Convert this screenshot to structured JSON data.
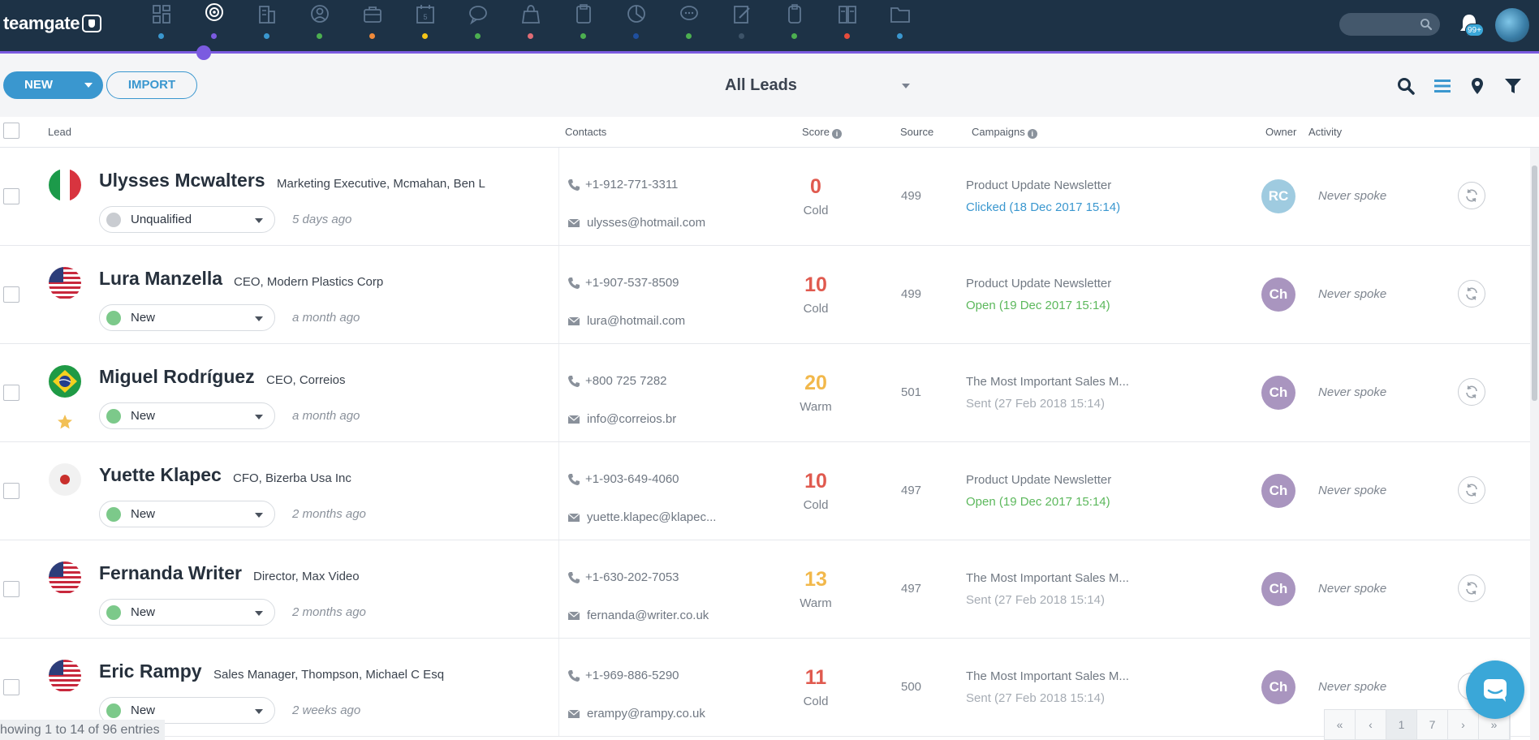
{
  "app": {
    "logo_text": "teamgate",
    "notifications_badge": "99+"
  },
  "nav": {
    "items": [
      {
        "icon": "dashboard-icon",
        "dot": "#3a97cf"
      },
      {
        "icon": "leads-target-icon",
        "dot": "#7b5be0",
        "active": true
      },
      {
        "icon": "companies-icon",
        "dot": "#3a97cf"
      },
      {
        "icon": "contacts-icon",
        "dot": "#4caf50"
      },
      {
        "icon": "deals-briefcase-icon",
        "dot": "#f08a3a"
      },
      {
        "icon": "calendar-icon",
        "dot": "#f5c518"
      },
      {
        "icon": "conversations-icon",
        "dot": "#4caf50"
      },
      {
        "icon": "bag-icon",
        "dot": "#e06c75"
      },
      {
        "icon": "clipboard-icon",
        "dot": "#4caf50"
      },
      {
        "icon": "reports-pie-icon",
        "dot": "#1f4f9e"
      },
      {
        "icon": "chat-icon",
        "dot": "#4caf50"
      },
      {
        "icon": "notes-edit-icon",
        "dot": "#3d5368"
      },
      {
        "icon": "documents-icon",
        "dot": "#4caf50"
      },
      {
        "icon": "invoices-icon",
        "dot": "#e74c3c"
      },
      {
        "icon": "folder-icon",
        "dot": "#3a97cf"
      }
    ]
  },
  "toolbar": {
    "new_label": "NEW",
    "import_label": "IMPORT",
    "view_label": "All Leads"
  },
  "table": {
    "headers": {
      "lead": "Lead",
      "contacts": "Contacts",
      "score": "Score",
      "source": "Source",
      "campaigns": "Campaigns",
      "owner": "Owner",
      "activity": "Activity"
    },
    "rows": [
      {
        "flag": "italy",
        "starred": false,
        "name": "Ulysses Mcwalters",
        "title": "Marketing Executive, Mcmahan, Ben L",
        "status": "Unqualified",
        "status_color": "#c9ccd1",
        "created": "5 days ago",
        "phone": "+1-912-771-3311",
        "email": "ulysses@hotmail.com",
        "score": "0",
        "score_label": "Cold",
        "score_color": "#e05a4f",
        "source": "499",
        "campaign": "Product Update Newsletter",
        "campaign_status": "Clicked (18 Dec 2017 15:14)",
        "campaign_status_color": "#3a97cf",
        "owner": "RC",
        "owner_color": "#9fcbe0",
        "activity": "Never spoke"
      },
      {
        "flag": "usa",
        "starred": false,
        "name": "Lura Manzella",
        "title": "CEO, Modern Plastics Corp",
        "status": "New",
        "status_color": "#7cc98a",
        "created": "a month ago",
        "phone": "+1-907-537-8509",
        "email": "lura@hotmail.com",
        "score": "10",
        "score_label": "Cold",
        "score_color": "#e05a4f",
        "source": "499",
        "campaign": "Product Update Newsletter",
        "campaign_status": "Open (19 Dec 2017 15:14)",
        "campaign_status_color": "#5cb85c",
        "owner": "Ch",
        "owner_color": "#a995bf",
        "activity": "Never spoke"
      },
      {
        "flag": "brazil",
        "starred": true,
        "name": "Miguel Rodríguez",
        "title": "CEO, Correios",
        "status": "New",
        "status_color": "#7cc98a",
        "created": "a month ago",
        "phone": "+800 725 7282",
        "email": "info@correios.br",
        "score": "20",
        "score_label": "Warm",
        "score_color": "#f2b84b",
        "source": "501",
        "campaign": "The Most Important Sales M...",
        "campaign_status": "Sent (27 Feb 2018 15:14)",
        "campaign_status_color": "#a6acb4",
        "owner": "Ch",
        "owner_color": "#a995bf",
        "activity": "Never spoke"
      },
      {
        "flag": "japan",
        "starred": false,
        "name": "Yuette Klapec",
        "title": "CFO, Bizerba Usa Inc",
        "status": "New",
        "status_color": "#7cc98a",
        "created": "2 months ago",
        "phone": "+1-903-649-4060",
        "email": "yuette.klapec@klapec...",
        "score": "10",
        "score_label": "Cold",
        "score_color": "#e05a4f",
        "source": "497",
        "campaign": "Product Update Newsletter",
        "campaign_status": "Open (19 Dec 2017 15:14)",
        "campaign_status_color": "#5cb85c",
        "owner": "Ch",
        "owner_color": "#a995bf",
        "activity": "Never spoke"
      },
      {
        "flag": "usa",
        "starred": false,
        "name": "Fernanda Writer",
        "title": "Director, Max Video",
        "status": "New",
        "status_color": "#7cc98a",
        "created": "2 months ago",
        "phone": "+1-630-202-7053",
        "email": "fernanda@writer.co.uk",
        "score": "13",
        "score_label": "Warm",
        "score_color": "#f2b84b",
        "source": "497",
        "campaign": "The Most Important Sales M...",
        "campaign_status": "Sent (27 Feb 2018 15:14)",
        "campaign_status_color": "#a6acb4",
        "owner": "Ch",
        "owner_color": "#a995bf",
        "activity": "Never spoke"
      },
      {
        "flag": "usa",
        "starred": false,
        "name": "Eric Rampy",
        "title": "Sales Manager, Thompson, Michael C Esq",
        "status": "New",
        "status_color": "#7cc98a",
        "created": "2 weeks ago",
        "phone": "+1-969-886-5290",
        "email": "erampy@rampy.co.uk",
        "score": "11",
        "score_label": "Cold",
        "score_color": "#e05a4f",
        "source": "500",
        "campaign": "The Most Important Sales M...",
        "campaign_status": "Sent (27 Feb 2018 15:14)",
        "campaign_status_color": "#a6acb4",
        "owner": "Ch",
        "owner_color": "#a995bf",
        "activity": "Never spoke"
      }
    ]
  },
  "footer": {
    "entries_text": "howing 1 to 14 of 96 entries",
    "pager": [
      "«",
      "‹",
      "1",
      "7",
      "›",
      "»"
    ],
    "current_page": "1"
  }
}
